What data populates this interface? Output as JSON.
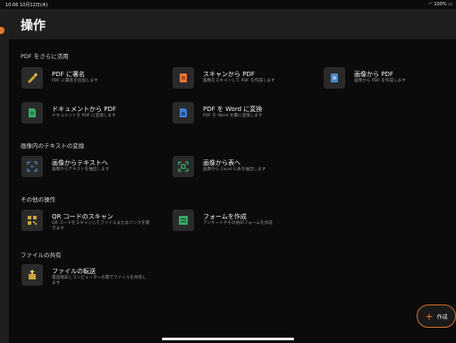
{
  "status_bar": {
    "time_date": "10:06  10月12日(木)",
    "battery": "100%"
  },
  "header": {
    "title": "操作"
  },
  "sections": [
    {
      "title": "PDF をさらに活用",
      "items": [
        {
          "label": "PDF に署名",
          "desc": "PDF に署名を追加します",
          "icon": "pen-sign-icon",
          "color": "#c9a43a"
        },
        {
          "label": "スキャンから PDF",
          "desc": "画像をスキャンして PDF を作成します",
          "icon": "scan-to-pdf-icon",
          "color": "#e8763a"
        },
        {
          "label": "画像から PDF",
          "desc": "画像から PDF を作成します",
          "icon": "image-to-pdf-icon",
          "color": "#4f86c6"
        },
        {
          "label": "ドキュメントから PDF",
          "desc": "ドキュメントを PDF に変換します",
          "icon": "document-to-pdf-icon",
          "color": "#3aa86b"
        },
        {
          "label": "PDF を Word に変換",
          "desc": "PDF を Word 文書に変換します",
          "icon": "pdf-to-word-icon",
          "color": "#3e7fd6"
        }
      ]
    },
    {
      "title": "画像内のテキストの変換",
      "items": [
        {
          "label": "画像からテキストへ",
          "desc": "画像からテキストを抽出します",
          "icon": "image-to-text-icon",
          "color": "#4f86c6"
        },
        {
          "label": "画像から表へ",
          "desc": "画像から Excel に表を抽出します",
          "icon": "image-to-table-icon",
          "color": "#3aa86b"
        }
      ]
    },
    {
      "title": "その他の操作",
      "items": [
        {
          "label": "QR コードのスキャン",
          "desc": "QR コードをスキャンしてファイルまたはリンクを開きます",
          "icon": "qr-code-icon",
          "color": "#c9a43a"
        },
        {
          "label": "フォームを作成",
          "desc": "アンケートやその他のフォームを作成",
          "icon": "forms-icon",
          "color": "#3aa86b"
        }
      ]
    },
    {
      "title": "ファイルの共有",
      "items": [
        {
          "label": "ファイルの転送",
          "desc": "電話端末とコンピューターの間でファイルを共有します",
          "icon": "file-transfer-icon",
          "color": "#c9a43a"
        }
      ]
    }
  ],
  "fab": {
    "label": "作成"
  }
}
